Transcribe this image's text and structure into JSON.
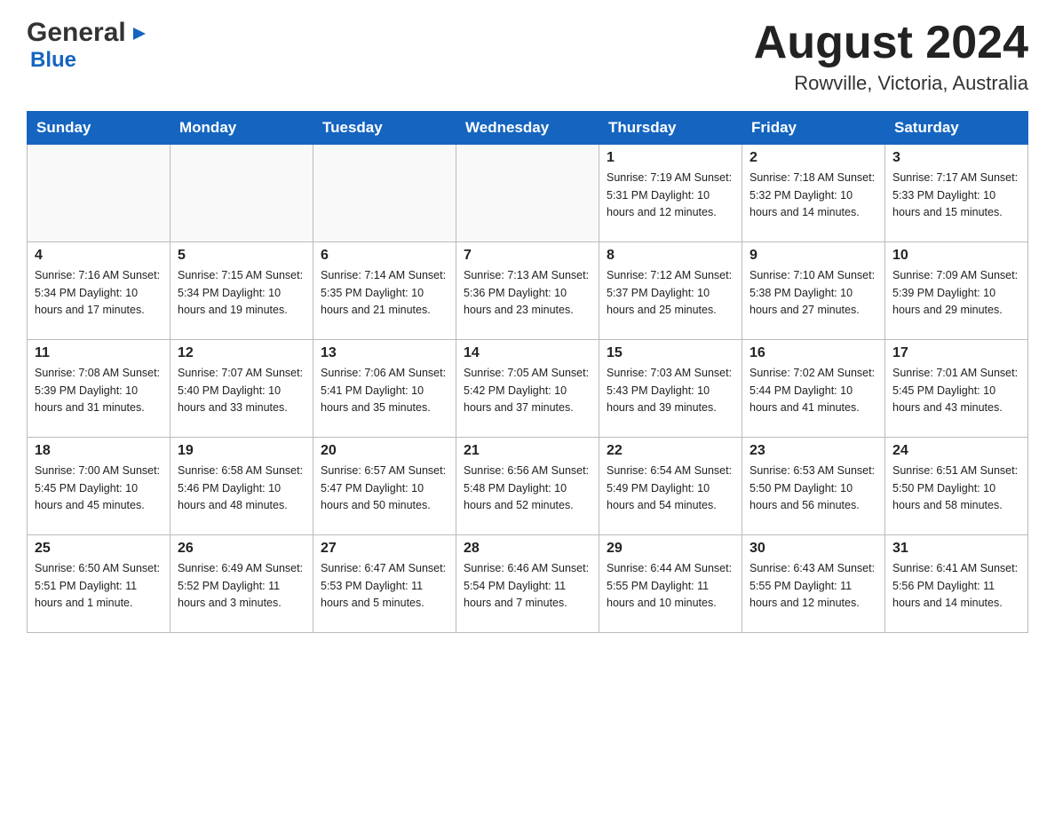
{
  "header": {
    "logo_general": "General",
    "logo_blue": "Blue",
    "main_title": "August 2024",
    "subtitle": "Rowville, Victoria, Australia"
  },
  "calendar": {
    "days_of_week": [
      "Sunday",
      "Monday",
      "Tuesday",
      "Wednesday",
      "Thursday",
      "Friday",
      "Saturday"
    ],
    "weeks": [
      [
        {
          "day": "",
          "info": ""
        },
        {
          "day": "",
          "info": ""
        },
        {
          "day": "",
          "info": ""
        },
        {
          "day": "",
          "info": ""
        },
        {
          "day": "1",
          "info": "Sunrise: 7:19 AM\nSunset: 5:31 PM\nDaylight: 10 hours\nand 12 minutes."
        },
        {
          "day": "2",
          "info": "Sunrise: 7:18 AM\nSunset: 5:32 PM\nDaylight: 10 hours\nand 14 minutes."
        },
        {
          "day": "3",
          "info": "Sunrise: 7:17 AM\nSunset: 5:33 PM\nDaylight: 10 hours\nand 15 minutes."
        }
      ],
      [
        {
          "day": "4",
          "info": "Sunrise: 7:16 AM\nSunset: 5:34 PM\nDaylight: 10 hours\nand 17 minutes."
        },
        {
          "day": "5",
          "info": "Sunrise: 7:15 AM\nSunset: 5:34 PM\nDaylight: 10 hours\nand 19 minutes."
        },
        {
          "day": "6",
          "info": "Sunrise: 7:14 AM\nSunset: 5:35 PM\nDaylight: 10 hours\nand 21 minutes."
        },
        {
          "day": "7",
          "info": "Sunrise: 7:13 AM\nSunset: 5:36 PM\nDaylight: 10 hours\nand 23 minutes."
        },
        {
          "day": "8",
          "info": "Sunrise: 7:12 AM\nSunset: 5:37 PM\nDaylight: 10 hours\nand 25 minutes."
        },
        {
          "day": "9",
          "info": "Sunrise: 7:10 AM\nSunset: 5:38 PM\nDaylight: 10 hours\nand 27 minutes."
        },
        {
          "day": "10",
          "info": "Sunrise: 7:09 AM\nSunset: 5:39 PM\nDaylight: 10 hours\nand 29 minutes."
        }
      ],
      [
        {
          "day": "11",
          "info": "Sunrise: 7:08 AM\nSunset: 5:39 PM\nDaylight: 10 hours\nand 31 minutes."
        },
        {
          "day": "12",
          "info": "Sunrise: 7:07 AM\nSunset: 5:40 PM\nDaylight: 10 hours\nand 33 minutes."
        },
        {
          "day": "13",
          "info": "Sunrise: 7:06 AM\nSunset: 5:41 PM\nDaylight: 10 hours\nand 35 minutes."
        },
        {
          "day": "14",
          "info": "Sunrise: 7:05 AM\nSunset: 5:42 PM\nDaylight: 10 hours\nand 37 minutes."
        },
        {
          "day": "15",
          "info": "Sunrise: 7:03 AM\nSunset: 5:43 PM\nDaylight: 10 hours\nand 39 minutes."
        },
        {
          "day": "16",
          "info": "Sunrise: 7:02 AM\nSunset: 5:44 PM\nDaylight: 10 hours\nand 41 minutes."
        },
        {
          "day": "17",
          "info": "Sunrise: 7:01 AM\nSunset: 5:45 PM\nDaylight: 10 hours\nand 43 minutes."
        }
      ],
      [
        {
          "day": "18",
          "info": "Sunrise: 7:00 AM\nSunset: 5:45 PM\nDaylight: 10 hours\nand 45 minutes."
        },
        {
          "day": "19",
          "info": "Sunrise: 6:58 AM\nSunset: 5:46 PM\nDaylight: 10 hours\nand 48 minutes."
        },
        {
          "day": "20",
          "info": "Sunrise: 6:57 AM\nSunset: 5:47 PM\nDaylight: 10 hours\nand 50 minutes."
        },
        {
          "day": "21",
          "info": "Sunrise: 6:56 AM\nSunset: 5:48 PM\nDaylight: 10 hours\nand 52 minutes."
        },
        {
          "day": "22",
          "info": "Sunrise: 6:54 AM\nSunset: 5:49 PM\nDaylight: 10 hours\nand 54 minutes."
        },
        {
          "day": "23",
          "info": "Sunrise: 6:53 AM\nSunset: 5:50 PM\nDaylight: 10 hours\nand 56 minutes."
        },
        {
          "day": "24",
          "info": "Sunrise: 6:51 AM\nSunset: 5:50 PM\nDaylight: 10 hours\nand 58 minutes."
        }
      ],
      [
        {
          "day": "25",
          "info": "Sunrise: 6:50 AM\nSunset: 5:51 PM\nDaylight: 11 hours\nand 1 minute."
        },
        {
          "day": "26",
          "info": "Sunrise: 6:49 AM\nSunset: 5:52 PM\nDaylight: 11 hours\nand 3 minutes."
        },
        {
          "day": "27",
          "info": "Sunrise: 6:47 AM\nSunset: 5:53 PM\nDaylight: 11 hours\nand 5 minutes."
        },
        {
          "day": "28",
          "info": "Sunrise: 6:46 AM\nSunset: 5:54 PM\nDaylight: 11 hours\nand 7 minutes."
        },
        {
          "day": "29",
          "info": "Sunrise: 6:44 AM\nSunset: 5:55 PM\nDaylight: 11 hours\nand 10 minutes."
        },
        {
          "day": "30",
          "info": "Sunrise: 6:43 AM\nSunset: 5:55 PM\nDaylight: 11 hours\nand 12 minutes."
        },
        {
          "day": "31",
          "info": "Sunrise: 6:41 AM\nSunset: 5:56 PM\nDaylight: 11 hours\nand 14 minutes."
        }
      ]
    ]
  }
}
